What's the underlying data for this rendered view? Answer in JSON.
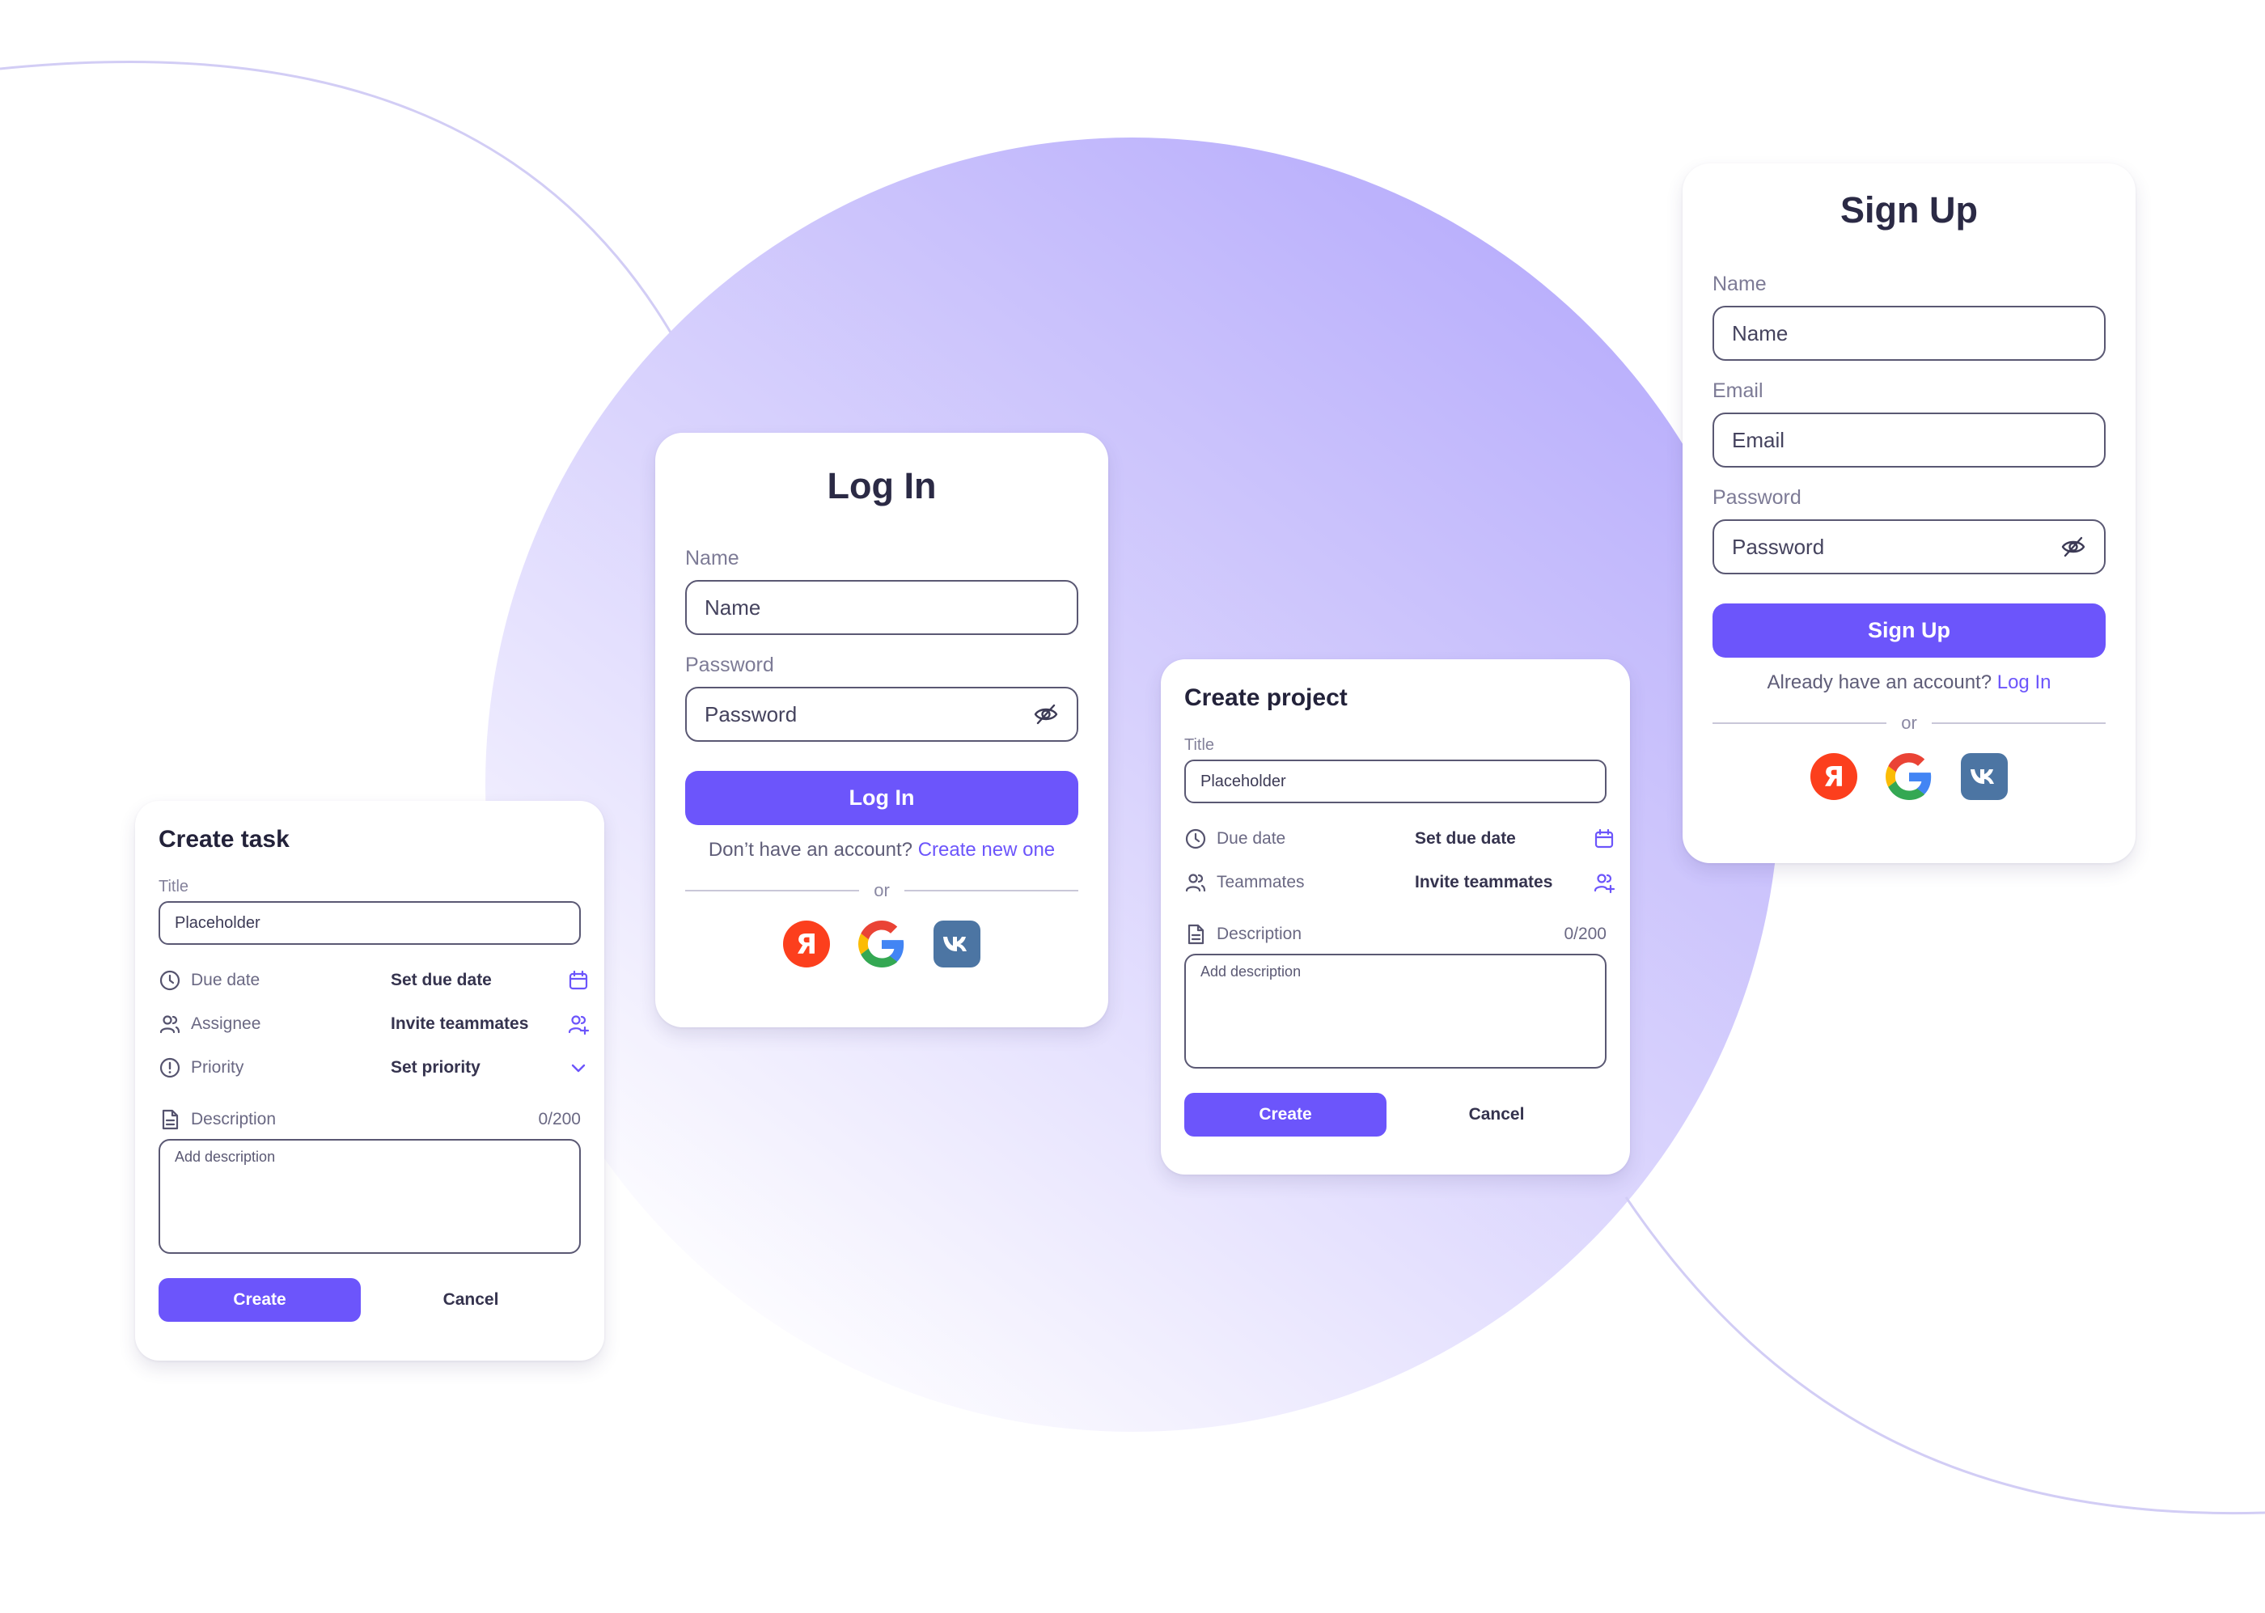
{
  "colors": {
    "accent": "#6c55fb",
    "text_dark": "#2b2a45",
    "text_muted": "#7d7b96",
    "circle_light": "#ece8ff",
    "circle_dark": "#b4a9fb",
    "yandex_red": "#fc3f1d",
    "vk_blue": "#4c75a3"
  },
  "login": {
    "title": "Log In",
    "name_label": "Name",
    "name_placeholder": "Name",
    "password_label": "Password",
    "password_placeholder": "Password",
    "submit_label": "Log In",
    "switch_text": "Don’t have an account?",
    "switch_link": "Create new one",
    "divider_text": "or",
    "social": [
      "yandex-logo",
      "google-logo",
      "vk-logo"
    ]
  },
  "signup": {
    "title": "Sign Up",
    "name_label": "Name",
    "name_placeholder": "Name",
    "email_label": "Email",
    "email_placeholder": "Email",
    "password_label": "Password",
    "password_placeholder": "Password",
    "submit_label": "Sign Up",
    "switch_text": "Already have an account?",
    "switch_link": "Log In",
    "divider_text": "or",
    "social": [
      "yandex-logo",
      "google-logo",
      "vk-logo"
    ]
  },
  "create_task": {
    "title": "Create task",
    "title_label": "Title",
    "title_placeholder": "Placeholder",
    "due_date_label": "Due date",
    "due_date_value": "Set due date",
    "assignee_label": "Assignee",
    "assignee_value": "Invite teammates",
    "priority_label": "Priority",
    "priority_value": "Set priority",
    "description_label": "Description",
    "description_counter": "0/200",
    "description_placeholder": "Add description",
    "create_label": "Create",
    "cancel_label": "Cancel"
  },
  "create_project": {
    "title": "Create project",
    "title_label": "Title",
    "title_placeholder": "Placeholder",
    "due_date_label": "Due date",
    "due_date_value": "Set due date",
    "teammates_label": "Teammates",
    "teammates_value": "Invite teammates",
    "description_label": "Description",
    "description_counter": "0/200",
    "description_placeholder": "Add description",
    "create_label": "Create",
    "cancel_label": "Cancel"
  }
}
